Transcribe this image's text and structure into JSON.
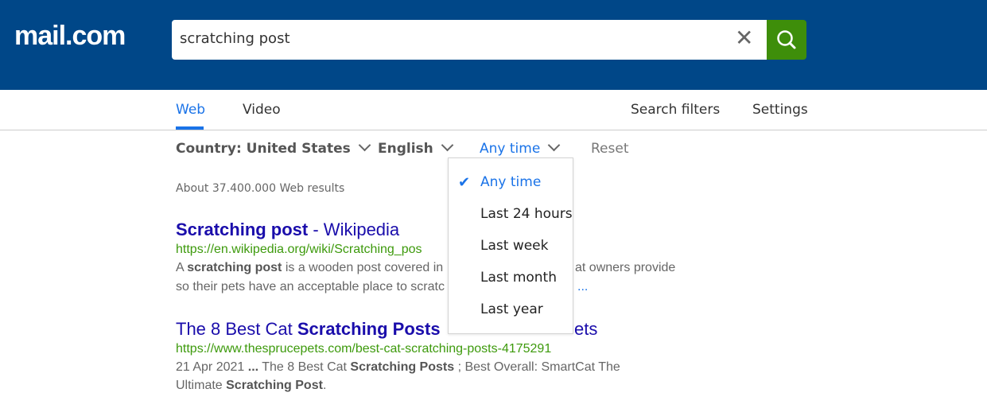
{
  "header": {
    "logo": "mail.com",
    "search_value": "scratching post",
    "clear_icon": "close-icon",
    "search_icon": "magnifier-icon",
    "colors": {
      "header": "#004788",
      "search_button": "#3e8e0a"
    }
  },
  "tabs": [
    {
      "label": "Web",
      "active": true
    },
    {
      "label": "Video"
    }
  ],
  "nav_right": {
    "filters": "Search filters",
    "settings": "Settings"
  },
  "filters": {
    "country": "Country: United States",
    "language": "English",
    "time": "Any time",
    "reset": "Reset"
  },
  "results_count": "About 37.400.000 Web results",
  "results": [
    {
      "title_bold": "Scratching post",
      "title_rest": " - Wikipedia",
      "url": "https://en.wikipedia.org/wiki/Scratching_pos",
      "snippet1": [
        "A ",
        "scratching post",
        " is a wooden post covered in",
        "at owners provide"
      ],
      "snippet2": [
        "so their pets have an acceptable place to scratc",
        "l ..."
      ]
    },
    {
      "title_a": "The 8 Best Cat ",
      "title_bold": "Scratching Posts",
      "title_end": "ets",
      "url": "https://www.thesprucepets.com/best-cat-scratching-posts-4175291",
      "snippet1": [
        "21 Apr 2021 ",
        "...",
        " The 8 Best Cat ",
        "Scratching Posts",
        " ; Best Overall: SmartCat The"
      ],
      "snippet2": [
        "Ultimate ",
        "Scratching Post",
        "."
      ]
    }
  ],
  "dropdown": {
    "options": [
      "Any time",
      "Last 24 hours",
      "Last week",
      "Last month",
      "Last year"
    ],
    "selected": "Any time"
  }
}
